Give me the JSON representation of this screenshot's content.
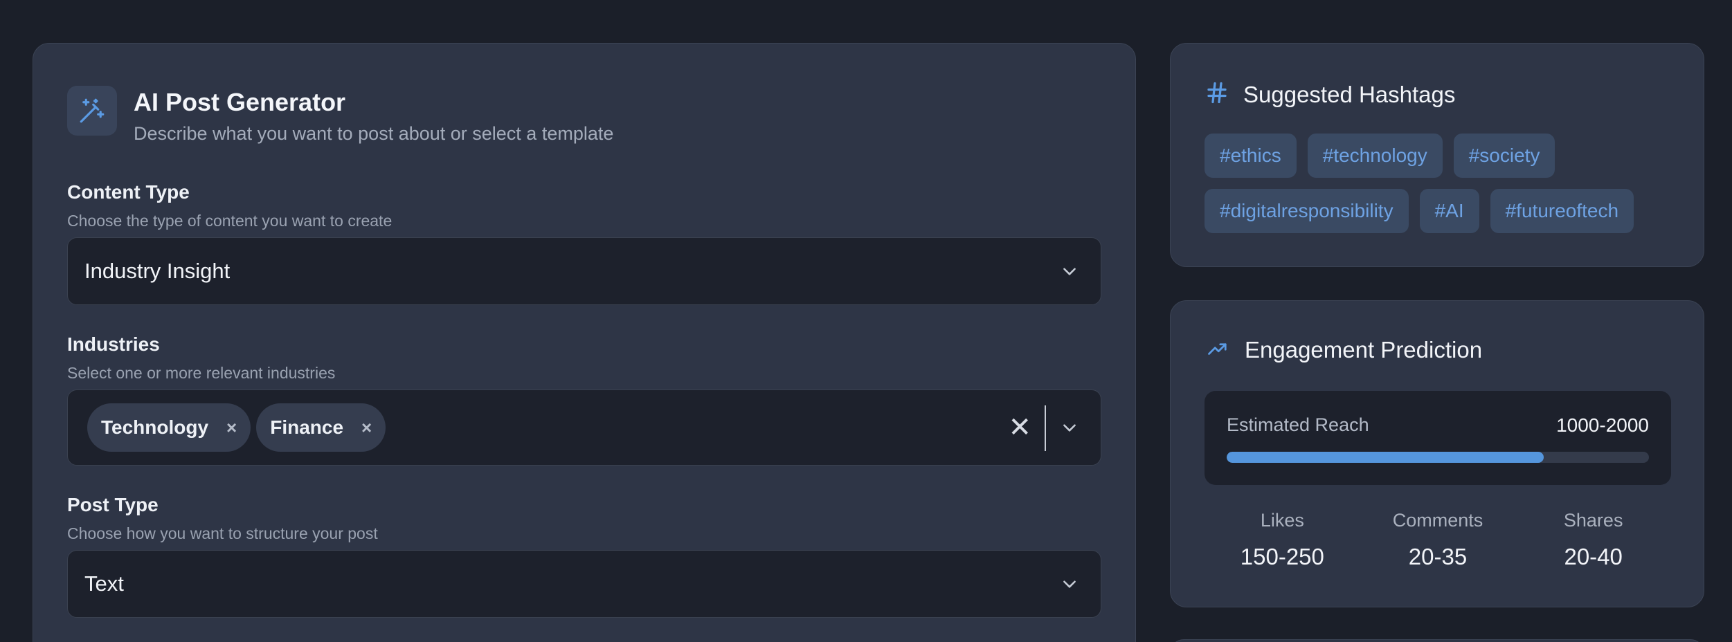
{
  "generator": {
    "title": "AI Post Generator",
    "subtitle": "Describe what you want to post about or select a template",
    "icon": "magic-wand-icon"
  },
  "content_type": {
    "label": "Content Type",
    "hint": "Choose the type of content you want to create",
    "value": "Industry Insight"
  },
  "industries": {
    "label": "Industries",
    "hint": "Select one or more relevant industries",
    "selected": [
      "Technology",
      "Finance"
    ],
    "remove_glyph": "×",
    "clear_glyph": "✕"
  },
  "post_type": {
    "label": "Post Type",
    "hint": "Choose how you want to structure your post",
    "value": "Text"
  },
  "hashtags": {
    "title": "Suggested Hashtags",
    "icon": "hash-icon",
    "items": [
      "#ethics",
      "#technology",
      "#society",
      "#digitalresponsibility",
      "#AI",
      "#futureoftech"
    ]
  },
  "engagement": {
    "title": "Engagement Prediction",
    "icon": "trending-up-icon",
    "reach_label": "Estimated Reach",
    "reach_value": "1000-2000",
    "reach_progress": 0.75,
    "stats": [
      {
        "label": "Likes",
        "value": "150-250"
      },
      {
        "label": "Comments",
        "value": "20-35"
      },
      {
        "label": "Shares",
        "value": "20-40"
      }
    ]
  },
  "colors": {
    "accent": "#5596dd",
    "background": "#1b1f29",
    "card": "#2e3546",
    "tag_bg": "#3a4a63",
    "tag_text": "#6ea2e3"
  }
}
